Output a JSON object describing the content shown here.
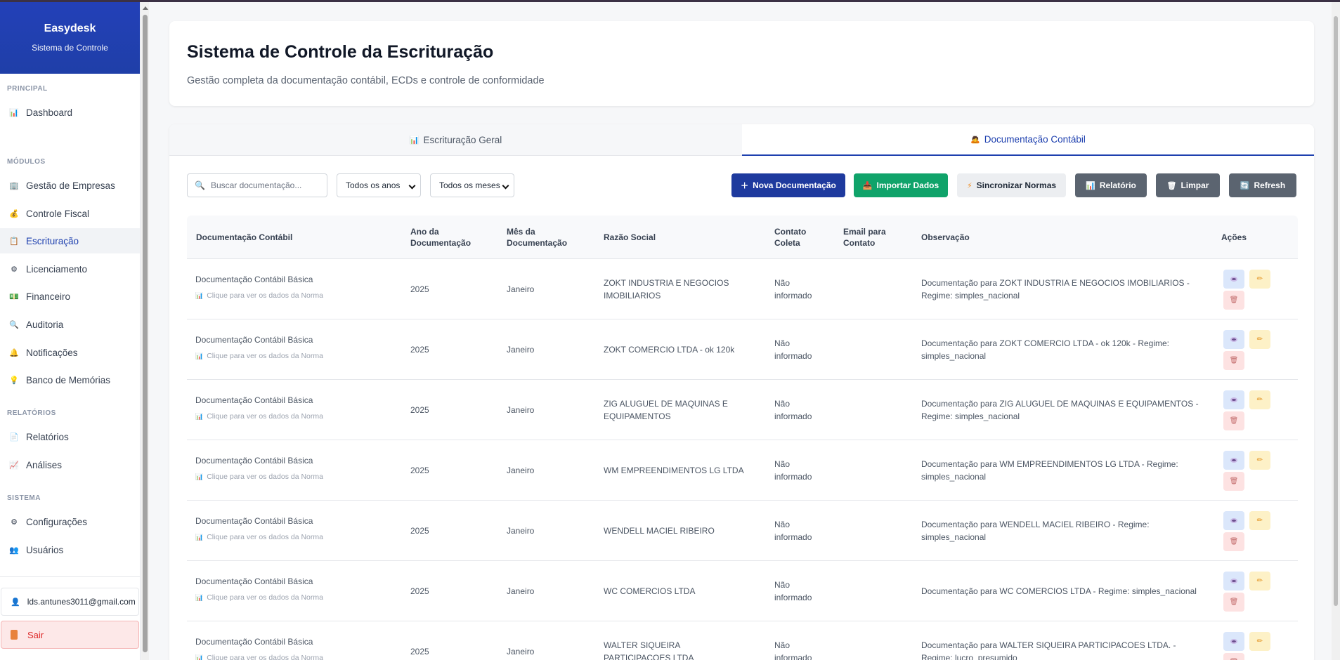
{
  "sidebar": {
    "brand_name": "Easydesk",
    "brand_sub": "Sistema de Controle",
    "sections": {
      "principal": "PRINCIPAL",
      "modulos": "MÓDULOS",
      "relatorios": "RELATÓRIOS",
      "sistema": "SISTEMA"
    },
    "items": [
      {
        "label": "Dashboard",
        "icon": "bar-chart-icon"
      },
      {
        "label": "Gestão de Empresas",
        "icon": "building-icon"
      },
      {
        "label": "Controle Fiscal",
        "icon": "money-bag-icon"
      },
      {
        "label": "Escrituração",
        "icon": "clipboard-icon"
      },
      {
        "label": "Licenciamento",
        "icon": "gear-icon"
      },
      {
        "label": "Financeiro",
        "icon": "dollar-bill-icon"
      },
      {
        "label": "Auditoria",
        "icon": "search-icon"
      },
      {
        "label": "Notificações",
        "icon": "bell-icon"
      },
      {
        "label": "Banco de Memórias",
        "icon": "lightbulb-icon"
      },
      {
        "label": "Relatórios",
        "icon": "document-icon"
      },
      {
        "label": "Análises",
        "icon": "line-chart-icon"
      },
      {
        "label": "Configurações",
        "icon": "gear-icon"
      },
      {
        "label": "Usuários",
        "icon": "users-icon"
      }
    ],
    "user_email": "lds.antunes3011@gmail.com",
    "logout_label": "Sair"
  },
  "header": {
    "title": "Sistema de Controle da Escrituração",
    "subtitle": "Gestão completa da documentação contábil, ECDs e controle de conformidade"
  },
  "tabs": [
    {
      "label": "Escrituração Geral",
      "active": false
    },
    {
      "label": "Documentação Contábil",
      "active": true
    }
  ],
  "toolbar": {
    "search_placeholder": "Buscar documentação...",
    "year_select": "Todos os anos",
    "month_select": "Todos os meses",
    "buttons": {
      "new": "Nova Documentação",
      "import": "Importar Dados",
      "sync": "Sincronizar Normas",
      "report": "Relatório",
      "clear": "Limpar",
      "refresh": "Refresh"
    }
  },
  "table": {
    "headers": {
      "doc": "Documentação Contábil",
      "ano": "Ano da Documentação",
      "mes": "Mês da Documentação",
      "razao": "Razão Social",
      "contato": "Contato Coleta",
      "email": "Email para Contato",
      "obs": "Observação",
      "acoes": "Ações"
    },
    "link_text": "Clique para ver os dados da Norma",
    "rows": [
      {
        "doc": "Documentação Contábil Básica",
        "ano": "2025",
        "mes": "Janeiro",
        "razao": "ZOKT INDUSTRIA E NEGOCIOS IMOBILIARIOS",
        "contato": "Não informado",
        "email": "",
        "obs": "Documentação para ZOKT INDUSTRIA E NEGOCIOS IMOBILIARIOS - Regime: simples_nacional"
      },
      {
        "doc": "Documentação Contábil Básica",
        "ano": "2025",
        "mes": "Janeiro",
        "razao": "ZOKT COMERCIO LTDA - ok 120k",
        "contato": "Não informado",
        "email": "",
        "obs": "Documentação para ZOKT COMERCIO LTDA - ok 120k - Regime: simples_nacional"
      },
      {
        "doc": "Documentação Contábil Básica",
        "ano": "2025",
        "mes": "Janeiro",
        "razao": "ZIG ALUGUEL DE MAQUINAS E EQUIPAMENTOS",
        "contato": "Não informado",
        "email": "",
        "obs": "Documentação para ZIG ALUGUEL DE MAQUINAS E EQUIPAMENTOS - Regime: simples_nacional"
      },
      {
        "doc": "Documentação Contábil Básica",
        "ano": "2025",
        "mes": "Janeiro",
        "razao": "WM EMPREENDIMENTOS LG LTDA",
        "contato": "Não informado",
        "email": "",
        "obs": "Documentação para WM EMPREENDIMENTOS LG LTDA - Regime: simples_nacional"
      },
      {
        "doc": "Documentação Contábil Básica",
        "ano": "2025",
        "mes": "Janeiro",
        "razao": "WENDELL MACIEL RIBEIRO",
        "contato": "Não informado",
        "email": "",
        "obs": "Documentação para WENDELL MACIEL RIBEIRO - Regime: simples_nacional"
      },
      {
        "doc": "Documentação Contábil Básica",
        "ano": "2025",
        "mes": "Janeiro",
        "razao": "WC COMERCIOS LTDA",
        "contato": "Não informado",
        "email": "",
        "obs": "Documentação para WC COMERCIOS LTDA - Regime: simples_nacional"
      },
      {
        "doc": "Documentação Contábil Básica",
        "ano": "2025",
        "mes": "Janeiro",
        "razao": "WALTER SIQUEIRA PARTICIPACOES LTDA",
        "contato": "Não informado",
        "email": "",
        "obs": "Documentação para WALTER SIQUEIRA PARTICIPACOES LTDA. - Regime: lucro_presumido"
      }
    ]
  }
}
